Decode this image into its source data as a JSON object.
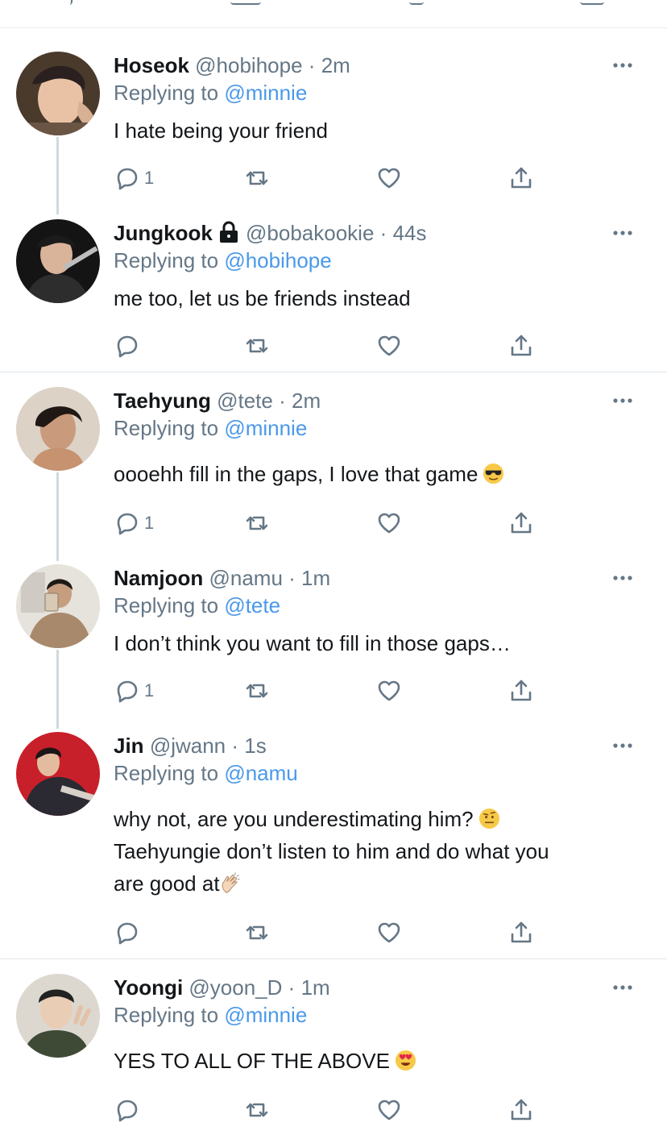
{
  "colors": {
    "name": "#14171a",
    "secondary": "#657786",
    "link": "#4a99e9",
    "divider": "#e1e8ed",
    "thread": "#cfd9de"
  },
  "tweets": [
    {
      "name": "Hoseok",
      "handle": "@hobihope",
      "dot": "·",
      "time": "2m",
      "reply_prefix": "Replying to",
      "reply_to": "@minnie",
      "body": "I hate being your friend",
      "reply_count": "1",
      "avatar_icon": "avatar-photo"
    },
    {
      "name": "Jungkook",
      "locked": true,
      "handle": "@bobakookie",
      "dot": "·",
      "time": "44s",
      "reply_prefix": "Replying to",
      "reply_to": "@hobihope",
      "body": "me too, let us be friends instead",
      "reply_count": "",
      "avatar_icon": "avatar-photo"
    },
    {
      "name": "Taehyung",
      "handle": "@tete",
      "dot": "·",
      "time": "2m",
      "reply_prefix": "Replying to",
      "reply_to": "@minnie",
      "body": "oooehh fill in the gaps, I love that game",
      "emoji": "sunglasses-emoji",
      "reply_count": "1",
      "avatar_icon": "avatar-photo"
    },
    {
      "name": "Namjoon",
      "handle": "@namu",
      "dot": "·",
      "time": "1m",
      "reply_prefix": "Replying to",
      "reply_to": "@tete",
      "body": "I don’t think you want to fill in those gaps…",
      "reply_count": "1",
      "avatar_icon": "avatar-photo"
    },
    {
      "name": "Jin",
      "handle": "@jwann",
      "dot": "·",
      "time": "1s",
      "reply_prefix": "Replying to",
      "reply_to": "@namu",
      "body_lines": [
        "why not, are you underestimating him?",
        "Taehyungie don’t listen to him and do what you",
        "are good at"
      ],
      "emojis": [
        "raised-eyebrow-emoji",
        "clapping-hands-emoji"
      ],
      "reply_count": "",
      "avatar_icon": "avatar-photo"
    },
    {
      "name": "Yoongi",
      "handle": "@yoon_D",
      "dot": "·",
      "time": "1m",
      "reply_prefix": "Replying to",
      "reply_to": "@minnie",
      "body": "YES TO ALL OF THE ABOVE",
      "emoji": "heart-eyes-emoji",
      "reply_count": "",
      "avatar_icon": "avatar-photo"
    }
  ]
}
